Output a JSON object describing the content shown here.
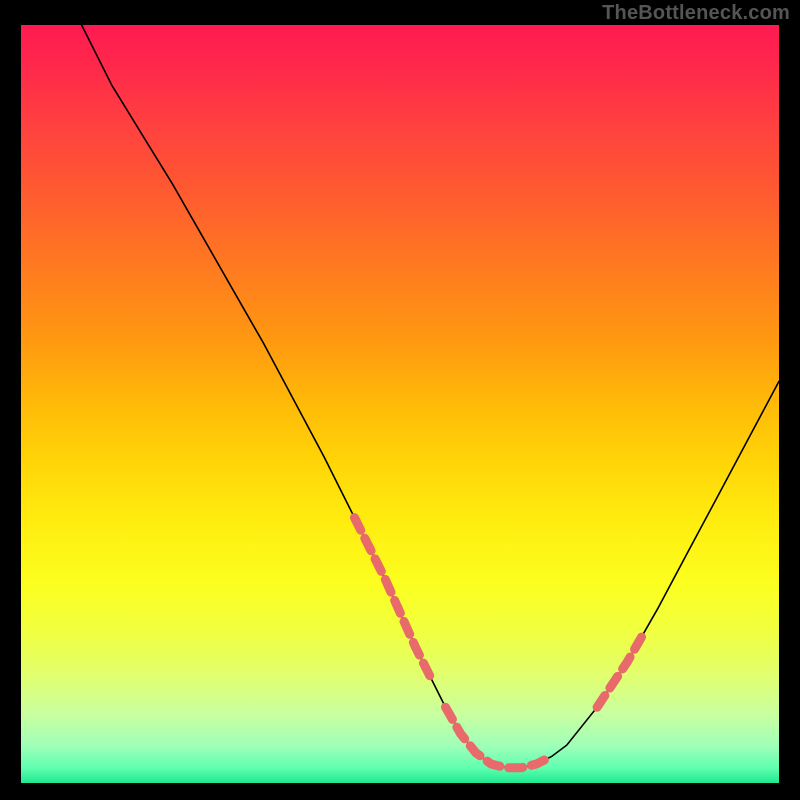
{
  "watermark": "TheBottleneck.com",
  "colors": {
    "frame_background": "#000000",
    "gradient_top": "#ff1a52",
    "gradient_bottom": "#20e890",
    "curve_stroke": "#000000",
    "marker_stroke": "#e86a6a",
    "watermark_text": "#555555"
  },
  "chart_data": {
    "type": "line",
    "title": "",
    "xlabel": "",
    "ylabel": "",
    "xlim": [
      0,
      100
    ],
    "ylim": [
      0,
      100
    ],
    "grid": false,
    "legend": false,
    "series": [
      {
        "name": "bottleneck-curve",
        "x": [
          8,
          12,
          16,
          20,
          24,
          28,
          32,
          36,
          40,
          44,
          48,
          52,
          54,
          56,
          58,
          60,
          62,
          64,
          66,
          68,
          70,
          72,
          76,
          80,
          84,
          88,
          92,
          96,
          100
        ],
        "values": [
          100,
          92,
          85.5,
          79,
          72,
          65,
          58,
          50.5,
          43,
          35,
          27,
          18,
          14,
          10,
          6.5,
          4,
          2.5,
          2,
          2,
          2.5,
          3.5,
          5,
          10,
          16,
          23,
          30.5,
          38,
          45.5,
          53
        ]
      }
    ],
    "markers": [
      {
        "name": "left-shoulder-dots",
        "style": "dashed-red",
        "x": [
          44,
          46,
          48,
          50,
          52,
          54
        ],
        "values": [
          35,
          31,
          27,
          22.5,
          18,
          14
        ]
      },
      {
        "name": "valley-floor-dots",
        "style": "dashed-red",
        "x": [
          56,
          58,
          60,
          62,
          64,
          66,
          68,
          70
        ],
        "values": [
          10,
          6.5,
          4,
          2.5,
          2,
          2,
          2.5,
          3.5
        ]
      },
      {
        "name": "right-shoulder-dots",
        "style": "dashed-red",
        "x": [
          76,
          78,
          80,
          82
        ],
        "values": [
          10,
          13,
          16,
          19.5
        ]
      }
    ],
    "annotations": []
  }
}
